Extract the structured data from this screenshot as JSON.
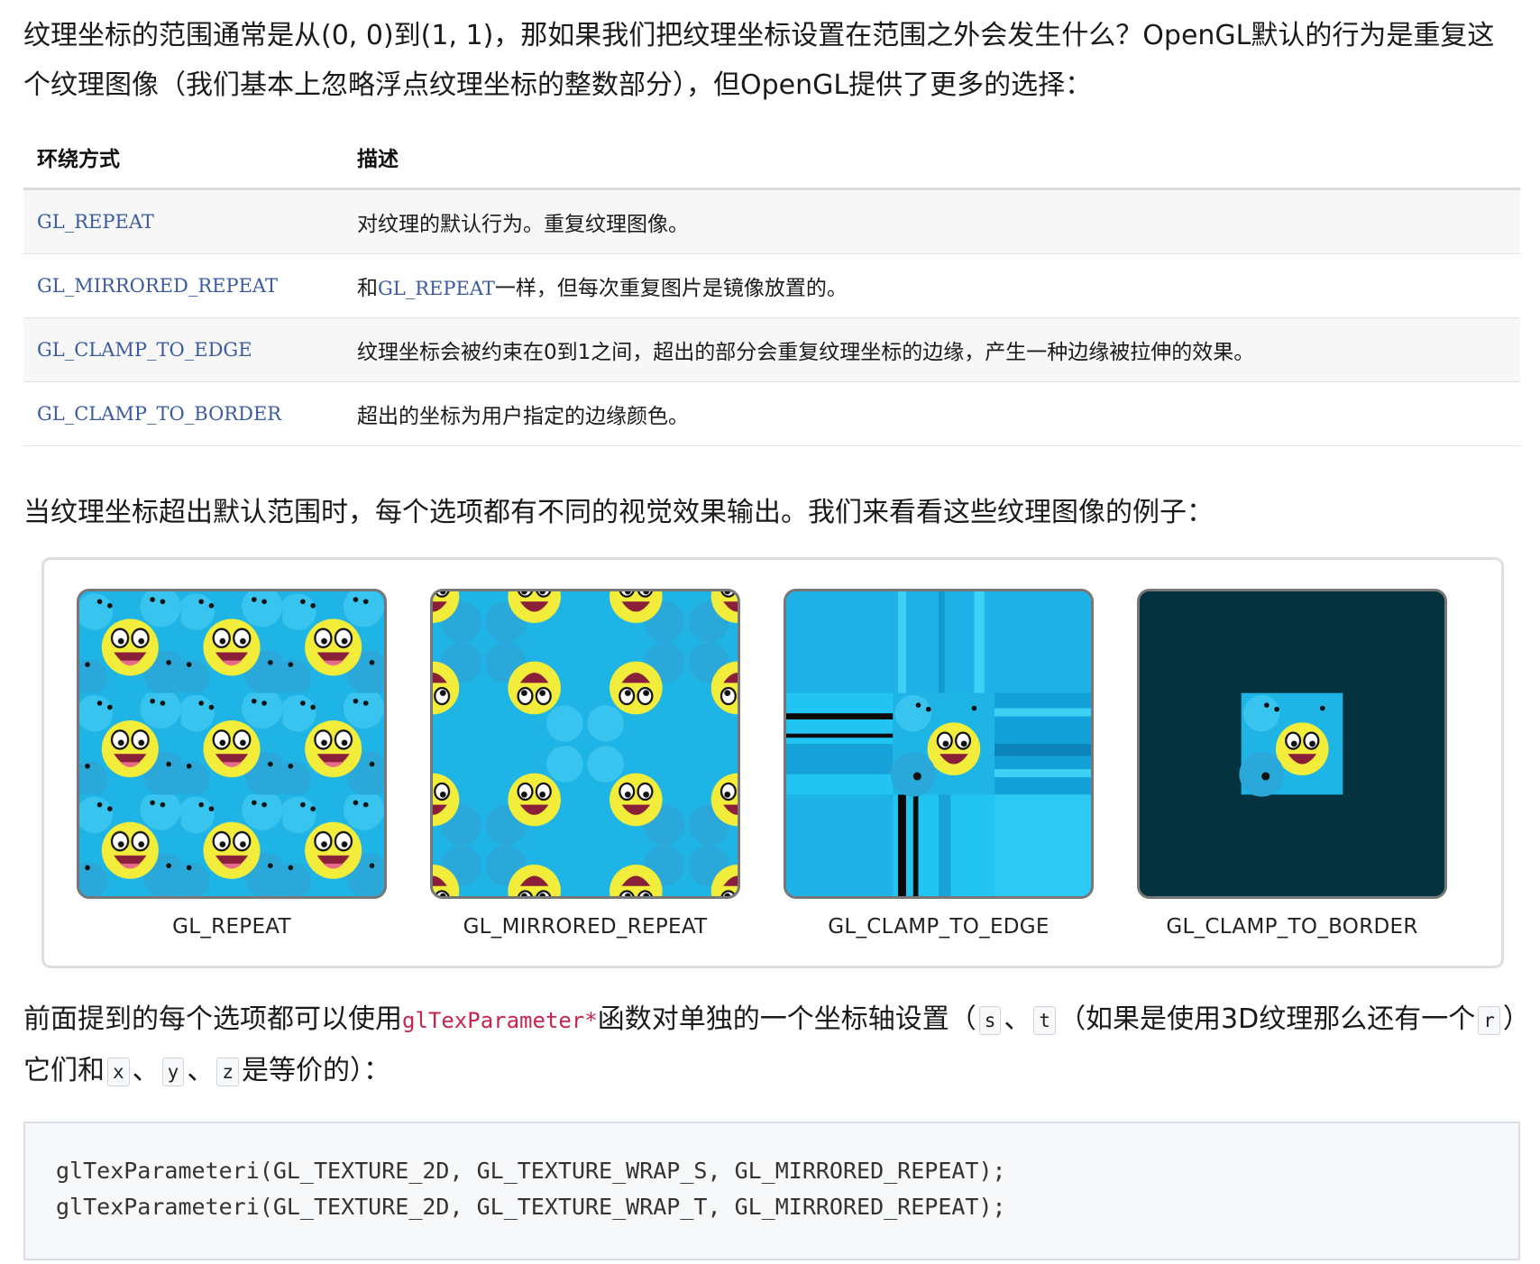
{
  "intro": {
    "text": "纹理坐标的范围通常是从(0, 0)到(1, 1)，那如果我们把纹理坐标设置在范围之外会发生什么？OpenGL默认的行为是重复这个纹理图像（我们基本上忽略浮点纹理坐标的整数部分），但OpenGL提供了更多的选择："
  },
  "table": {
    "headers": [
      "环绕方式",
      "描述"
    ],
    "rows": [
      {
        "mode": "GL_REPEAT",
        "desc": "对纹理的默认行为。重复纹理图像。"
      },
      {
        "mode": "GL_MIRRORED_REPEAT",
        "desc_pre": "和",
        "desc_code": "GL_REPEAT",
        "desc_post": "一样，但每次重复图片是镜像放置的。"
      },
      {
        "mode": "GL_CLAMP_TO_EDGE",
        "desc": "纹理坐标会被约束在0到1之间，超出的部分会重复纹理坐标的边缘，产生一种边缘被拉伸的效果。"
      },
      {
        "mode": "GL_CLAMP_TO_BORDER",
        "desc": "超出的坐标为用户指定的边缘颜色。"
      }
    ]
  },
  "para2": {
    "text": "当纹理坐标超出默认范围时，每个选项都有不同的视觉效果输出。我们来看看这些纹理图像的例子："
  },
  "figure": {
    "captions": [
      "GL_REPEAT",
      "GL_MIRRORED_REPEAT",
      "GL_CLAMP_TO_EDGE",
      "GL_CLAMP_TO_BORDER"
    ],
    "colors": {
      "sky": "#1eb4e6",
      "face": "#f2ec3a",
      "border_fill": "#05323f"
    }
  },
  "para3": {
    "t1": "前面提到的每个选项都可以使用",
    "code": "glTexParameter*",
    "t2": "函数对单独的一个坐标轴设置（",
    "s": "s",
    "sep1": "、",
    "t": "t",
    "t3": "（如果是使用3D纹理那么还有一个",
    "r": "r",
    "t4": "）它们和",
    "x": "x",
    "sep2": "、",
    "y": "y",
    "sep3": "、",
    "z": "z",
    "t5": "是等价的）："
  },
  "code": {
    "line1": "glTexParameteri(GL_TEXTURE_2D, GL_TEXTURE_WRAP_S, GL_MIRRORED_REPEAT);",
    "line2": "glTexParameteri(GL_TEXTURE_2D, GL_TEXTURE_WRAP_T, GL_MIRRORED_REPEAT);"
  }
}
